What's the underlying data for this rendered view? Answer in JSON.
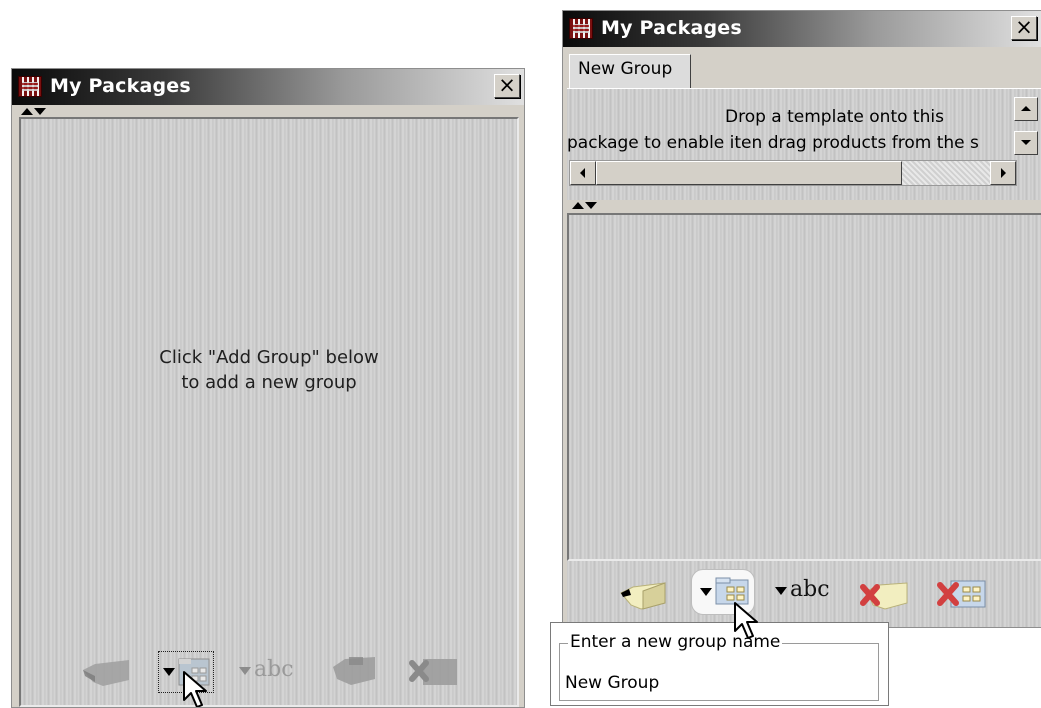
{
  "left_panel": {
    "title": "My Packages",
    "close_label": "×",
    "empty_message_line1": "Click \"Add Group\" below",
    "empty_message_line2": "to add a new group",
    "rename_label": "abc"
  },
  "right_panel": {
    "title": "My Packages",
    "close_label": "×",
    "tab_label": "New Group",
    "description_line1": "Drop a template onto this",
    "description_line2": "package to enable iten drag products from the s",
    "rename_label": "abc"
  },
  "popup": {
    "legend": "Enter a new group name",
    "value": "New Group"
  },
  "icons": {
    "package": "package-icon",
    "add_group": "add-group-icon",
    "delete_item": "delete-item-icon",
    "delete_group": "delete-group-icon",
    "cursor": "mouse-pointer-icon"
  },
  "colors": {
    "title_gradient_dark": "#0a0a0a",
    "title_gradient_light": "#e0e0e0",
    "window_face": "#d4d0c8",
    "metal_bg": "#cfcfcf",
    "delete_red": "#d24040"
  }
}
